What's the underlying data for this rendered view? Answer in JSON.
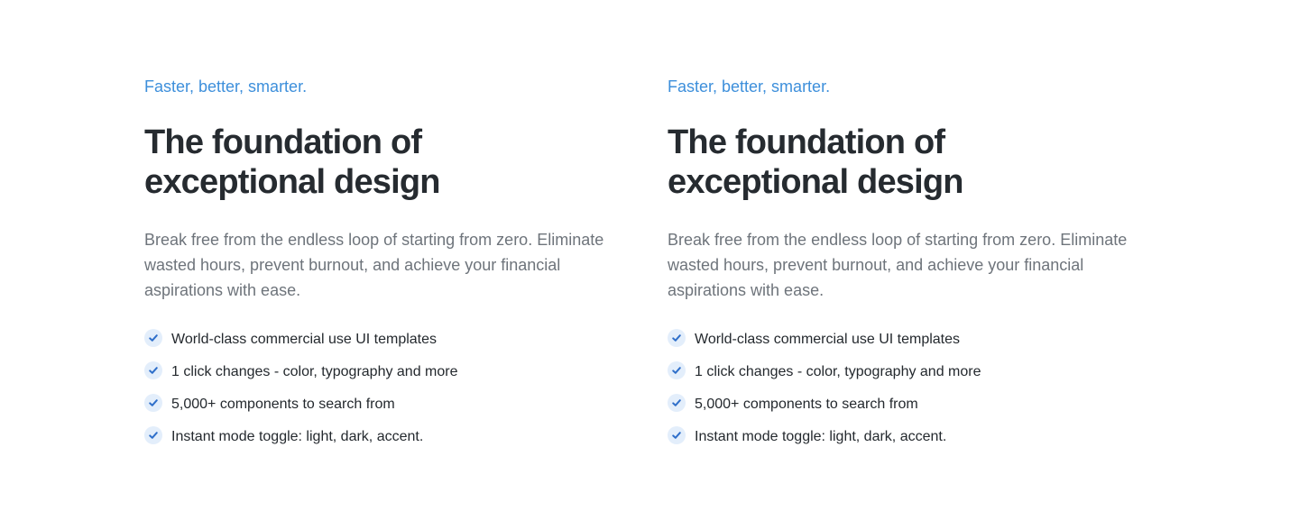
{
  "colors": {
    "accent": "#3d8fdb",
    "heading": "#262b30",
    "body": "#6e747b",
    "feature_text": "#24292e",
    "check_bg": "#e3eefb",
    "check_mark": "#2f6fca"
  },
  "sections": [
    {
      "eyebrow": "Faster, better, smarter.",
      "headline_line1": "The foundation of",
      "headline_line2": "exceptional design",
      "description": "Break free from the endless loop of starting from zero. Eliminate wasted hours, prevent burnout, and achieve your financial aspirations with ease.",
      "features": [
        {
          "icon": "check-icon",
          "label": "World-class commercial use UI templates"
        },
        {
          "icon": "check-icon",
          "label": "1 click changes - color, typography and more"
        },
        {
          "icon": "check-icon",
          "label": "5,000+ components to search from"
        },
        {
          "icon": "check-icon",
          "label": "Instant mode toggle: light, dark, accent."
        }
      ]
    },
    {
      "eyebrow": "Faster, better, smarter.",
      "headline_line1": "The foundation of",
      "headline_line2": "exceptional design",
      "description": "Break free from the endless loop of starting from zero. Eliminate wasted hours, prevent burnout, and achieve your financial aspirations with ease.",
      "features": [
        {
          "icon": "check-icon",
          "label": "World-class commercial use UI templates"
        },
        {
          "icon": "check-icon",
          "label": "1 click changes - color, typography and more"
        },
        {
          "icon": "check-icon",
          "label": "5,000+ components to search from"
        },
        {
          "icon": "check-icon",
          "label": "Instant mode toggle: light, dark, accent."
        }
      ]
    }
  ]
}
